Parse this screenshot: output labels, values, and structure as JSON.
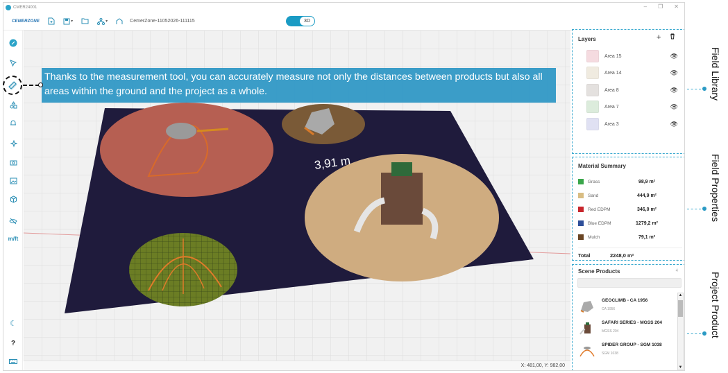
{
  "window": {
    "title": "CMER24001"
  },
  "toolbar": {
    "brand": "CEMERZONE",
    "project_name": "CemerZone-11052026-111115",
    "view_toggle": "3D"
  },
  "callout": {
    "text": "Thanks to the measurement tool, you can accurately measure not only the distances between products but also all areas within the ground and the project as a whole."
  },
  "viewport": {
    "measurement_label": "3,91 m",
    "coords": "X: 481,00, Y: 982,00"
  },
  "sidebar": {
    "unit_toggle": "m/ft",
    "help": "?"
  },
  "layers": {
    "title": "Layers",
    "items": [
      {
        "name": "Area 15",
        "color": "#f5dbe0"
      },
      {
        "name": "Area 14",
        "color": "#f0ebe0"
      },
      {
        "name": "Area 8",
        "color": "#e4e1df"
      },
      {
        "name": "Area 7",
        "color": "#dcecdc"
      },
      {
        "name": "Area 3",
        "color": "#e0e1f3"
      }
    ]
  },
  "material_summary": {
    "title": "Material Summary",
    "items": [
      {
        "name": "Grass",
        "value": "98,9 m²",
        "color": "#3aa64a"
      },
      {
        "name": "Sand",
        "value": "444,9 m²",
        "color": "#d9bd83"
      },
      {
        "name": "Red EDPM",
        "value": "346,0 m²",
        "color": "#c8262c"
      },
      {
        "name": "Blue EDPM",
        "value": "1279,2 m²",
        "color": "#2e4f9a"
      },
      {
        "name": "Mulch",
        "value": "79,1 m²",
        "color": "#6a4524"
      }
    ],
    "total_label": "Total",
    "total_value": "2248,0 m²"
  },
  "scene_products": {
    "title": "Scene Products",
    "count": "4",
    "items": [
      {
        "name": "GEOCLIMB - CA 1956",
        "code": "CA 1956"
      },
      {
        "name": "SAFARI SERIES - MGSS 204",
        "code": "MGSS 204"
      },
      {
        "name": "SPIDER GROUP - SGM 1038",
        "code": "SGM 1038"
      }
    ]
  },
  "side_labels": [
    "Field Library",
    "Field Properties",
    "Project Product"
  ]
}
